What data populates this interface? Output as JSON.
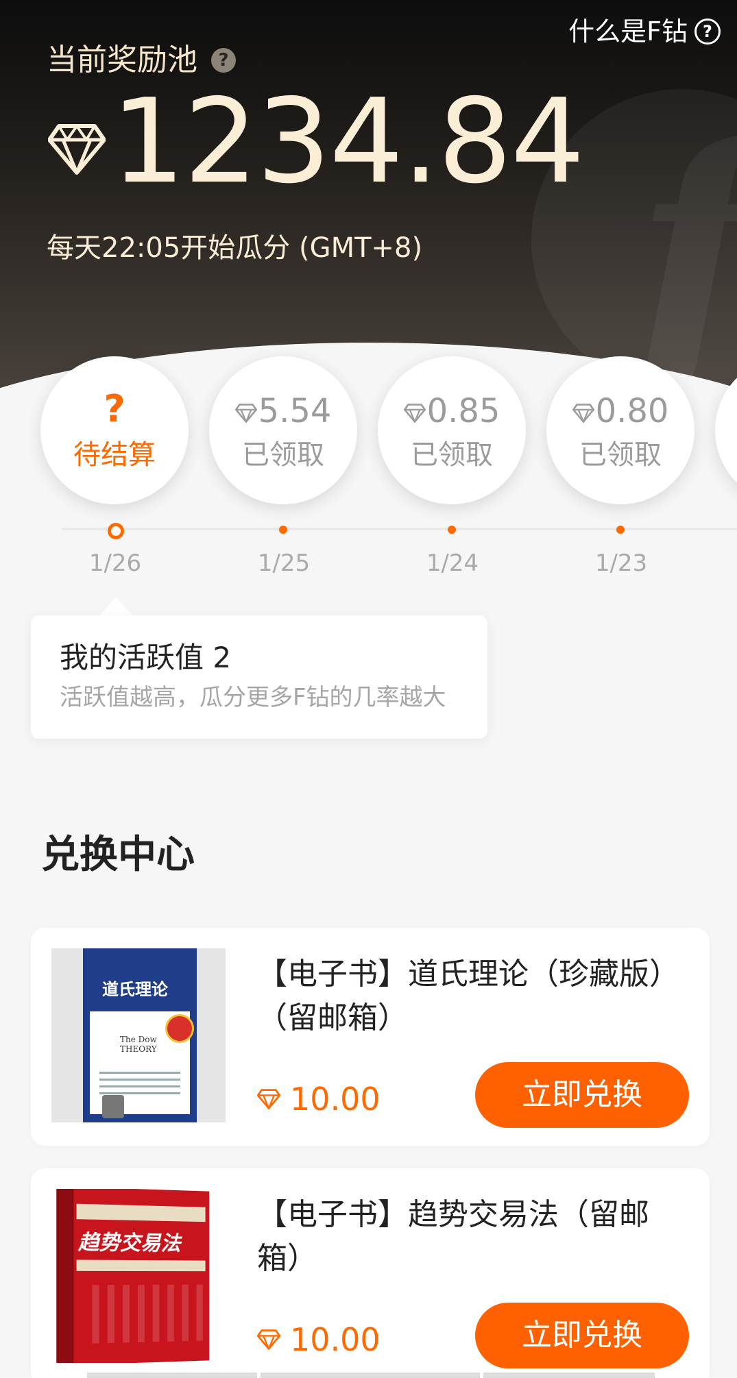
{
  "header": {
    "pool_label": "当前奖励池",
    "help_icon": "question-circle-icon",
    "what_is_link": "什么是F钻",
    "pool_amount": "1234.84",
    "schedule": "每天22:05开始瓜分 (GMT+8)"
  },
  "days": [
    {
      "amount": "",
      "status": "待结算",
      "date": "1/26",
      "state": "pending",
      "mark": "?"
    },
    {
      "amount": "5.54",
      "status": "已领取",
      "date": "1/25",
      "state": "claimed"
    },
    {
      "amount": "0.85",
      "status": "已领取",
      "date": "1/24",
      "state": "claimed"
    },
    {
      "amount": "0.80",
      "status": "已领取",
      "date": "1/23",
      "state": "claimed"
    }
  ],
  "activity": {
    "title": "我的活跃值 2",
    "subtitle": "活跃值越高，瓜分更多F钻的几率越大"
  },
  "exchange": {
    "title": "兑换中心",
    "products": [
      {
        "name": "【电子书】道氏理论（珍藏版）（留邮箱）",
        "price": "10.00",
        "button": "立即兑换",
        "cover_title": "道氏理论",
        "cover_sub": "The Dow THEORY"
      },
      {
        "name": "【电子书】趋势交易法（留邮箱）",
        "price": "10.00",
        "button": "立即兑换",
        "cover_title": "趋势交易法"
      }
    ]
  },
  "colors": {
    "accent": "#ff6000",
    "header_text": "#fbeed6",
    "muted": "#9b9b9b"
  }
}
